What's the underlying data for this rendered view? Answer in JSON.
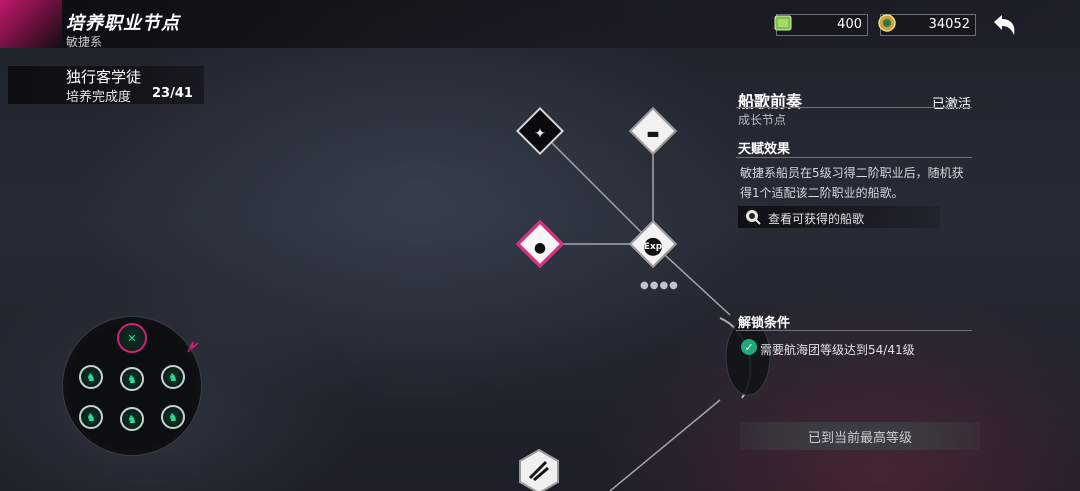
{
  "header": {
    "title": "培养职业节点",
    "subtitle": "敏捷系"
  },
  "resources": [
    {
      "name": "gem-resource",
      "value": "400",
      "icon": "green-crystal-icon"
    },
    {
      "name": "gold-resource",
      "value": "34052",
      "icon": "gold-coin-icon"
    }
  ],
  "class_info": {
    "name": "独行客学徒",
    "progress_label": "培养完成度",
    "progress_value": "23/41"
  },
  "detail": {
    "skill_name": "船歌前奏",
    "status": "已激活",
    "skill_type": "成长节点",
    "effect_title": "天赋效果",
    "effect_text": "敏捷系船员在5级习得二阶职业后，随机获得1个适配该二阶职业的船歌。",
    "view_label": "查看可获得的船歌",
    "unlock_title": "解锁条件",
    "unlock_condition": "需要航海团等级达到54/41级",
    "max_button": "已到当前最高等级"
  },
  "colors": {
    "accent": "#d21f78",
    "check": "#1fa87a"
  }
}
